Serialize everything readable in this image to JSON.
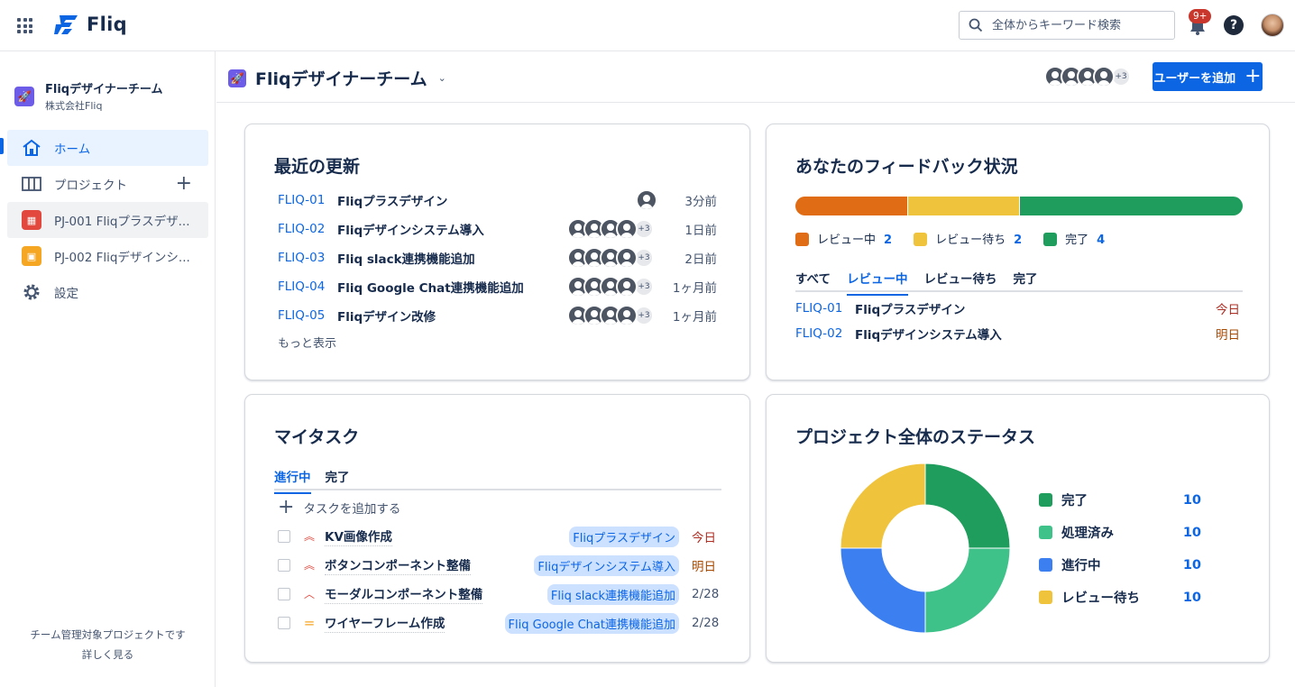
{
  "topbar": {
    "app_name": "Fliq",
    "search_placeholder": "全体からキーワード検索",
    "notif_badge": "9+",
    "help_label": "?"
  },
  "sidebar": {
    "team_name": "Fliqデザイナーチーム",
    "company": "株式会社Fliq",
    "items": [
      {
        "label": "ホーム",
        "icon": "home-icon"
      },
      {
        "label": "プロジェクト",
        "icon": "board-icon"
      },
      {
        "label": "PJ-001 Fliqプラスデザ...",
        "icon": "project-red-icon"
      },
      {
        "label": "PJ-002 Fliqデザインシ...",
        "icon": "project-yellow-icon"
      },
      {
        "label": "設定",
        "icon": "gear-icon"
      }
    ],
    "footer_text": "チーム管理対象プロジェクトです",
    "footer_link": "詳しく見る"
  },
  "header": {
    "title": "Fliqデザイナーチーム",
    "more_count": "+3",
    "add_user_label": "ユーザーを追加"
  },
  "recent": {
    "title": "最近の更新",
    "rows": [
      {
        "key": "FLIQ-01",
        "title": "Fliqプラスデザイン",
        "time": "3分前"
      },
      {
        "key": "FLIQ-02",
        "title": "Fliqデザインシステム導入",
        "more": "+3",
        "time": "1日前"
      },
      {
        "key": "FLIQ-03",
        "title": "Fliq slack連携機能追加",
        "more": "+3",
        "time": "2日前"
      },
      {
        "key": "FLIQ-04",
        "title": "Fliq Google Chat連携機能追加",
        "more": "+3",
        "time": "1ヶ月前"
      },
      {
        "key": "FLIQ-05",
        "title": "Fliqデザイン改修",
        "more": "+3",
        "time": "1ヶ月前"
      }
    ],
    "more_link": "もっと表示"
  },
  "feedback": {
    "title": "あなたのフィードバック状況",
    "segments": [
      {
        "label": "レビュー中",
        "count": "2",
        "color": "#e06c16"
      },
      {
        "label": "レビュー待ち",
        "count": "2",
        "color": "#f0c33c"
      },
      {
        "label": "完了",
        "count": "4",
        "color": "#1f9d5c"
      }
    ],
    "tabs": [
      "すべて",
      "レビュー中",
      "レビュー待ち",
      "完了"
    ],
    "rows": [
      {
        "key": "FLIQ-01",
        "title": "Fliqプラスデザイン",
        "due": "今日"
      },
      {
        "key": "FLIQ-02",
        "title": "Fliqデザインシステム導入",
        "due": "明日"
      }
    ]
  },
  "mytask": {
    "title": "マイタスク",
    "tabs": [
      "進行中",
      "完了"
    ],
    "add_label": "タスクを追加する",
    "tasks": [
      {
        "title": "KV画像作成",
        "tag": "Fliqプラスデザイン",
        "due": "今日"
      },
      {
        "title": "ボタンコンポーネント整備",
        "tag": "Fliqデザインシステム導入",
        "due": "明日"
      },
      {
        "title": "モーダルコンポーネント整備",
        "tag": "Fliq slack連携機能追加",
        "due": "2/28"
      },
      {
        "title": "ワイヤーフレーム作成",
        "tag": "Fliq Google Chat連携機能追加",
        "due": "2/28"
      }
    ]
  },
  "status": {
    "title": "プロジェクト全体のステータス",
    "chart_data": {
      "type": "pie",
      "categories": [
        "完了",
        "処理済み",
        "進行中",
        "レビュー待ち"
      ],
      "values": [
        10,
        10,
        10,
        10
      ],
      "colors": [
        "#1f9d5c",
        "#3fc28a",
        "#3b7ff0",
        "#f0c33c"
      ]
    }
  }
}
